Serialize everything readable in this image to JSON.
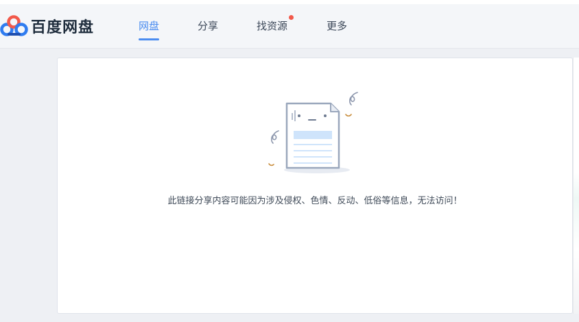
{
  "app": {
    "name": "百度网盘",
    "logo_icon": "baidu-netdisk-cloud-icon",
    "brand_colors": {
      "blue": "#2f7cf0",
      "red": "#f2594b",
      "navy": "#1f2d3d"
    }
  },
  "nav": {
    "items": [
      {
        "label": "网盘",
        "active": true
      },
      {
        "label": "分享",
        "active": false
      },
      {
        "label": "找资源",
        "active": false,
        "badge": "red-dot"
      },
      {
        "label": "更多",
        "active": false
      }
    ],
    "active_color": "#4a8cf0"
  },
  "main": {
    "illustration_icon": "blocked-document-icon",
    "message": "此链接分享内容可能因为涉及侵权、色情、反动、低俗等信息，无法访问！"
  }
}
